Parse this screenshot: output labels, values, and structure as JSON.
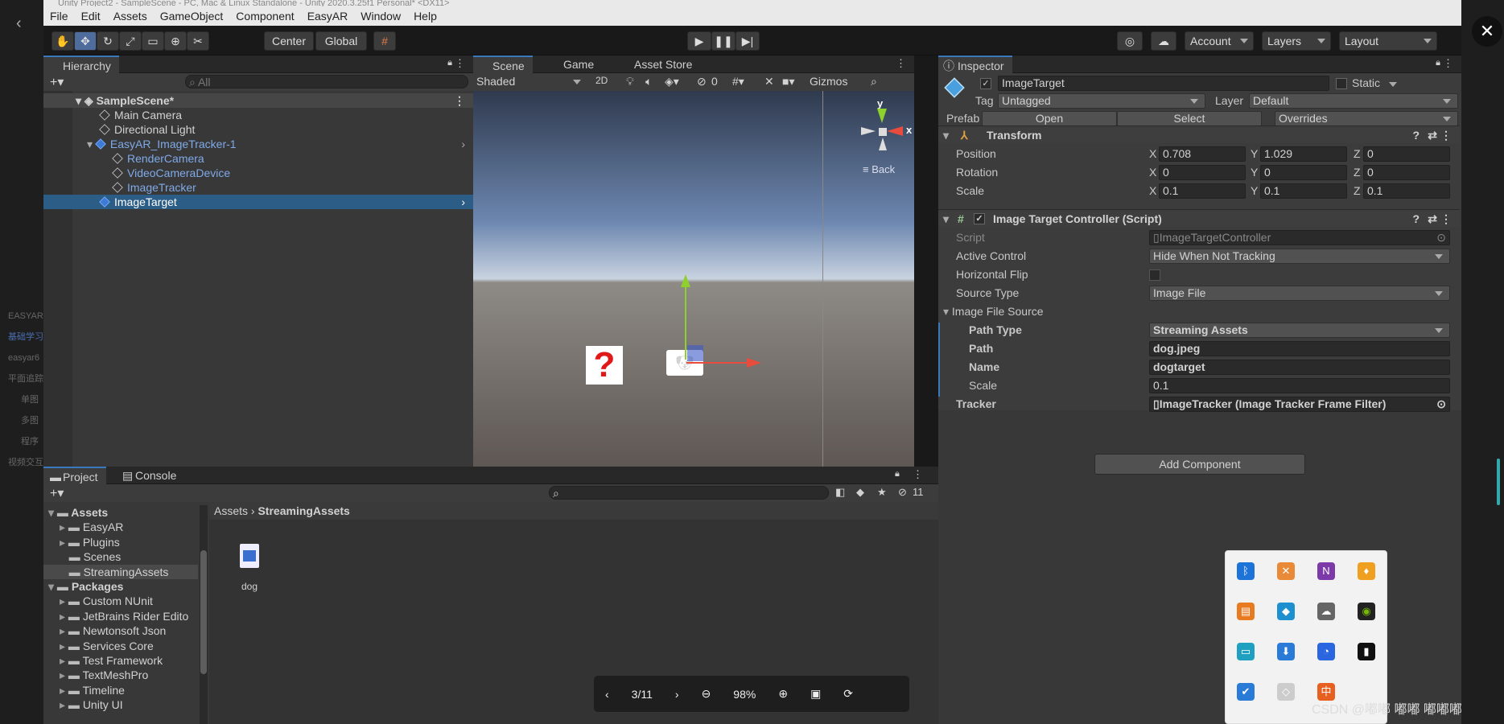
{
  "window": {
    "title": "Unity Project2 - SampleScene - PC, Mac & Linux Standalone - Unity 2020.3.25f1 Personal* <DX11>"
  },
  "menu": [
    "File",
    "Edit",
    "Assets",
    "GameObject",
    "Component",
    "EasyAR",
    "Window",
    "Help"
  ],
  "toolbar": {
    "center": "Center",
    "global": "Global",
    "account": "Account",
    "layers": "Layers",
    "layout": "Layout"
  },
  "hierarchy": {
    "tab": "Hierarchy",
    "search_placeholder": "All",
    "scene": "SampleScene*",
    "items": [
      "Main Camera",
      "Directional Light",
      "EasyAR_ImageTracker-1",
      "RenderCamera",
      "VideoCameraDevice",
      "ImageTracker",
      "ImageTarget"
    ]
  },
  "scene": {
    "tabs": [
      "Scene",
      "Game",
      "Asset Store"
    ],
    "shading": "Shaded",
    "mode2d": "2D",
    "hidden_count": "0",
    "gizmos": "Gizmos",
    "axis_y": "y",
    "axis_x": "x",
    "back": "Back"
  },
  "project": {
    "tabs": [
      "Project",
      "Console"
    ],
    "hidden_count": "11",
    "breadcrumb": [
      "Assets",
      "StreamingAssets"
    ],
    "tree": [
      {
        "label": "Assets",
        "bold": true
      },
      {
        "label": "EasyAR"
      },
      {
        "label": "Plugins"
      },
      {
        "label": "Scenes"
      },
      {
        "label": "StreamingAssets"
      },
      {
        "label": "Packages",
        "bold": true
      },
      {
        "label": "Custom NUnit"
      },
      {
        "label": "JetBrains Rider Edito"
      },
      {
        "label": "Newtonsoft Json"
      },
      {
        "label": "Services Core"
      },
      {
        "label": "Test Framework"
      },
      {
        "label": "TextMeshPro"
      },
      {
        "label": "Timeline"
      },
      {
        "label": "Unity UI"
      }
    ],
    "file": "dog"
  },
  "inspector": {
    "tab": "Inspector",
    "name": "ImageTarget",
    "static": "Static",
    "tag_label": "Tag",
    "tag": "Untagged",
    "layer_label": "Layer",
    "layer": "Default",
    "prefab_label": "Prefab",
    "open": "Open",
    "select": "Select",
    "overrides": "Overrides",
    "transform": {
      "title": "Transform",
      "position": "Position",
      "rotation": "Rotation",
      "scale": "Scale",
      "px": "0.708",
      "py": "1.029",
      "pz": "0",
      "rx": "0",
      "ry": "0",
      "rz": "0",
      "sx": "0.1",
      "sy": "0.1",
      "sz": "0.1",
      "X": "X",
      "Y": "Y",
      "Z": "Z"
    },
    "script": {
      "title": "Image Target Controller (Script)",
      "script_label": "Script",
      "script_value": "ImageTargetController",
      "active_label": "Active Control",
      "active_value": "Hide When Not Tracking",
      "flip_label": "Horizontal Flip",
      "source_label": "Source Type",
      "source_value": "Image File",
      "file_source": "Image File Source",
      "path_type_label": "Path Type",
      "path_type_value": "Streaming Assets",
      "path_label": "Path",
      "path_value": "dog.jpeg",
      "name_label": "Name",
      "name_value": "dogtarget",
      "scale_label": "Scale",
      "scale_value": "0.1",
      "tracker_label": "Tracker",
      "tracker_value": "ImageTracker (Image Tracker Frame Filter)"
    },
    "add_component": "Add Component"
  },
  "viewer": {
    "page": "3/11",
    "zoom": "98%"
  },
  "side_left": [
    "EASYAR",
    "基础学习",
    "easyar6",
    "平面追踪",
    "单图",
    "多图",
    "程序",
    "视频交互"
  ],
  "watermark": "CSDN @嘟嘟 嘟嘟 嘟嘟嘟"
}
